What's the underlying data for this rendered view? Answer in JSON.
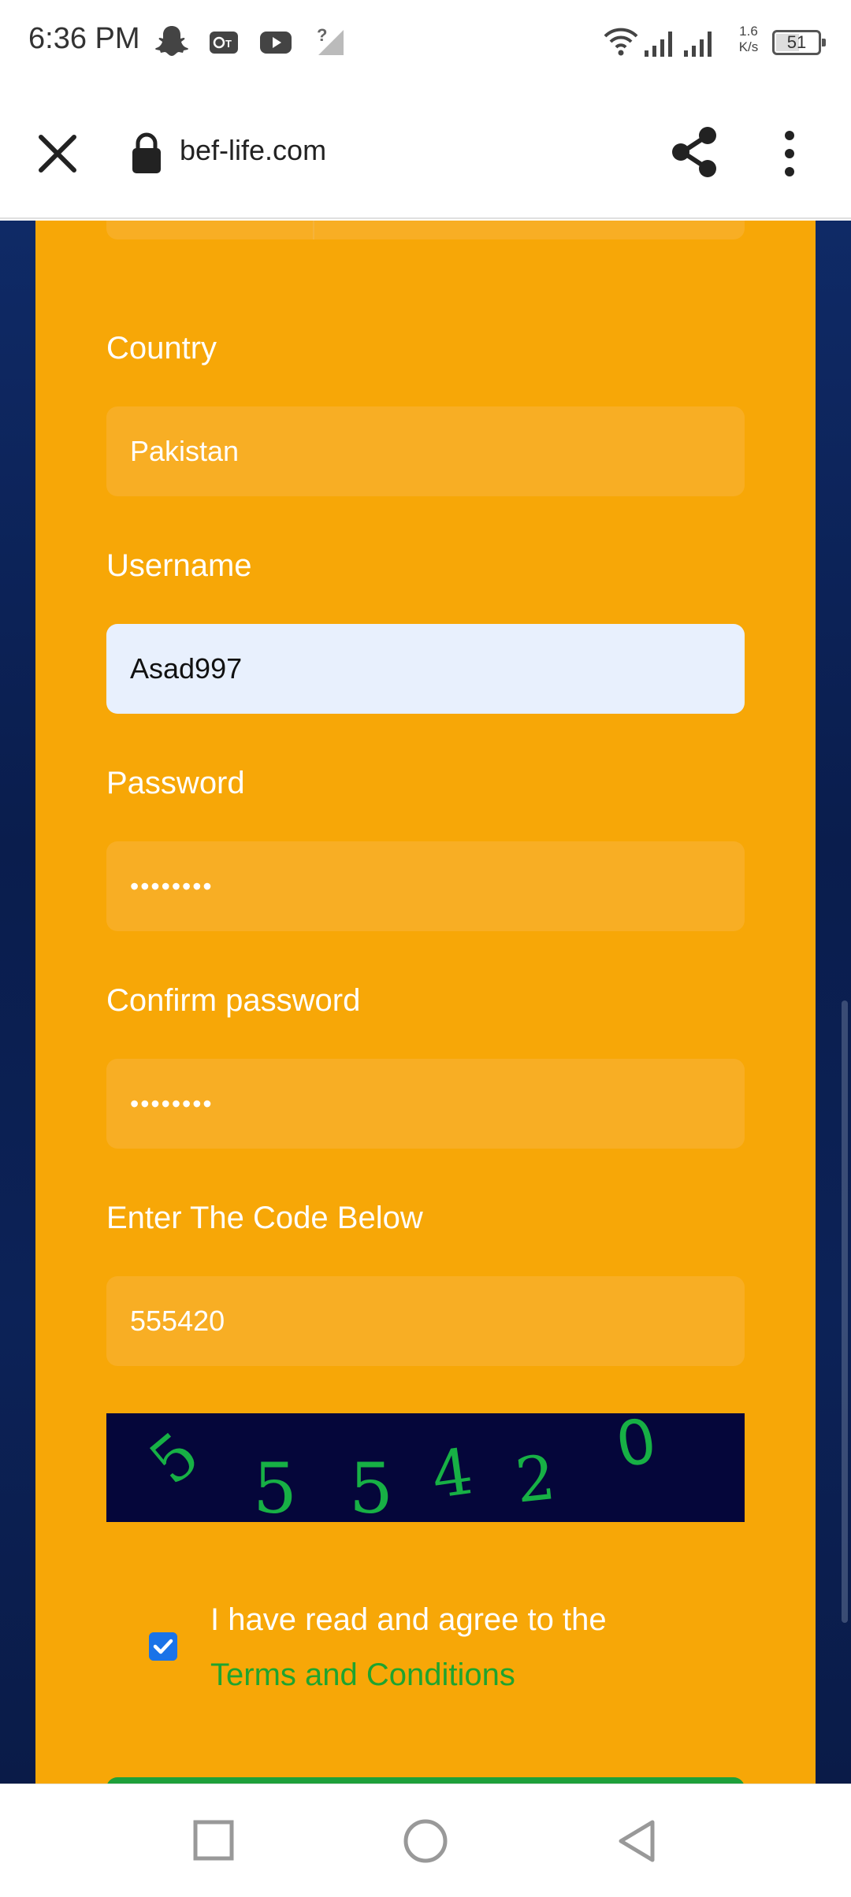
{
  "status_bar": {
    "time": "6:36 PM",
    "speed_value": "1.6",
    "speed_unit": "K/s",
    "battery": "51",
    "icons": [
      "snapchat-icon",
      "vpn-app-icon",
      "youtube-icon",
      "no-signal-icon",
      "wifi-icon",
      "signal-icon",
      "signal-icon"
    ]
  },
  "browser": {
    "url": "bef-life.com",
    "icons": [
      "close-icon",
      "lock-icon",
      "share-icon",
      "more-vert-icon"
    ]
  },
  "form": {
    "country": {
      "label": "Country",
      "value": "Pakistan"
    },
    "username": {
      "label": "Username",
      "value": "Asad997"
    },
    "password": {
      "label": "Password",
      "value": "••••••••"
    },
    "confirm_password": {
      "label": "Confirm password",
      "value": "••••••••"
    },
    "code": {
      "label": "Enter The Code Below",
      "value": "555420"
    },
    "captcha_digits": [
      "5",
      "5",
      "5",
      "4",
      "2",
      "0"
    ],
    "terms": {
      "checked": true,
      "text": "I have read and agree to the",
      "link": "Terms and Conditions"
    }
  },
  "colors": {
    "card": "#f7a707",
    "input": "#f8ae24",
    "filled_input": "#e8f0fd",
    "link": "#1ea42f",
    "captcha_bg": "#05063a",
    "captcha_digits": "#17b045",
    "checkbox": "#1a73e8"
  },
  "nav": {
    "icons": [
      "recents-square-icon",
      "home-circle-icon",
      "back-triangle-icon"
    ]
  }
}
